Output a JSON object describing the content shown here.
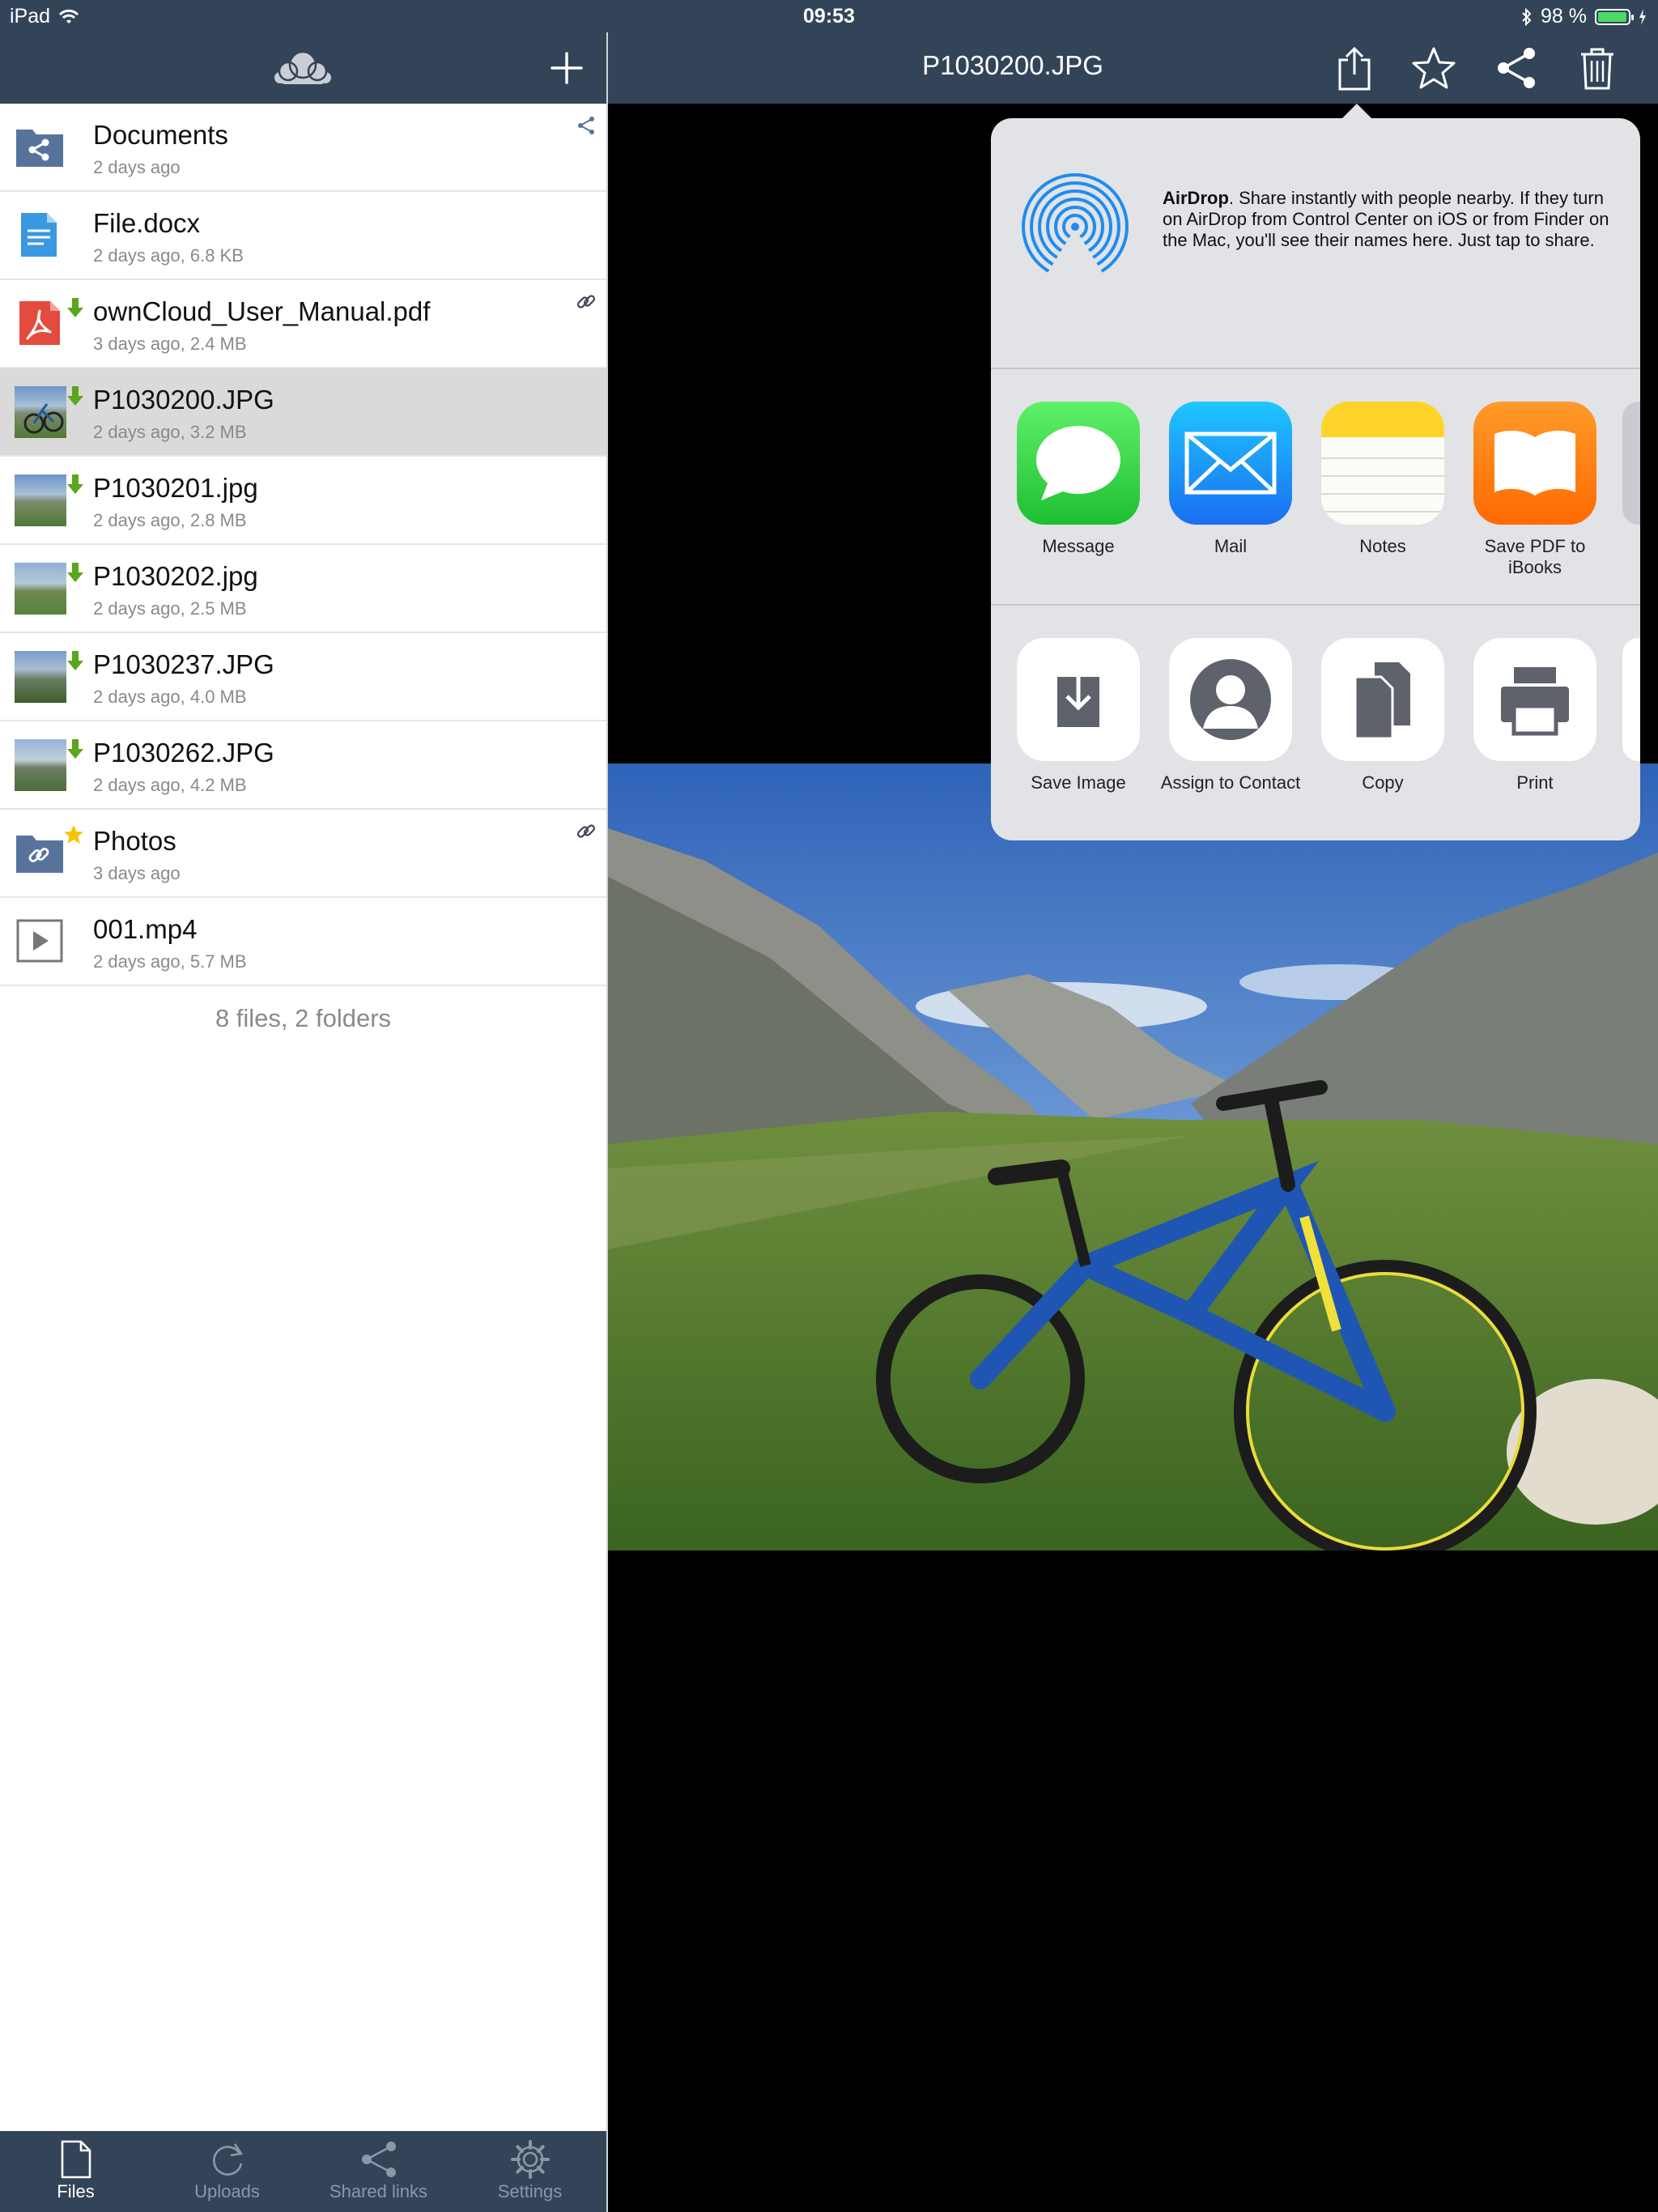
{
  "status_bar": {
    "device": "iPad",
    "time": "09:53",
    "battery": "98 %",
    "battery_level": 0.98
  },
  "preview": {
    "title": "P1030200.JPG"
  },
  "files": [
    {
      "name": "Documents",
      "meta": "2 days ago",
      "type": "folder-shared",
      "badge": "",
      "corner": "share-icon",
      "selected": false
    },
    {
      "name": "File.docx",
      "meta": "2 days ago, 6.8 KB",
      "type": "doc",
      "badge": "",
      "corner": "",
      "selected": false
    },
    {
      "name": "ownCloud_User_Manual.pdf",
      "meta": "3 days ago, 2.4 MB",
      "type": "pdf",
      "badge": "downloaded",
      "corner": "link-icon",
      "selected": false
    },
    {
      "name": "P1030200.JPG",
      "meta": "2 days ago, 3.2 MB",
      "type": "image",
      "badge": "downloaded",
      "corner": "",
      "selected": true
    },
    {
      "name": "P1030201.jpg",
      "meta": "2 days ago, 2.8 MB",
      "type": "image",
      "badge": "downloaded",
      "corner": "",
      "selected": false
    },
    {
      "name": "P1030202.jpg",
      "meta": "2 days ago, 2.5 MB",
      "type": "image",
      "badge": "downloaded",
      "corner": "",
      "selected": false
    },
    {
      "name": "P1030237.JPG",
      "meta": "2 days ago, 4.0 MB",
      "type": "image",
      "badge": "downloaded",
      "corner": "",
      "selected": false
    },
    {
      "name": "P1030262.JPG",
      "meta": "2 days ago, 4.2 MB",
      "type": "image",
      "badge": "downloaded",
      "corner": "",
      "selected": false
    },
    {
      "name": "Photos",
      "meta": "3 days ago",
      "type": "folder-link",
      "badge": "favorite",
      "corner": "link-icon",
      "selected": false
    },
    {
      "name": "001.mp4",
      "meta": "2 days ago, 5.7 MB",
      "type": "video",
      "badge": "",
      "corner": "",
      "selected": false
    }
  ],
  "summary": "8 files, 2 folders",
  "tabs": [
    {
      "label": "Files",
      "icon": "file-icon",
      "active": true
    },
    {
      "label": "Uploads",
      "icon": "refresh-icon",
      "active": false
    },
    {
      "label": "Shared links",
      "icon": "share-icon",
      "active": false
    },
    {
      "label": "Settings",
      "icon": "gear-icon",
      "active": false
    }
  ],
  "share_sheet": {
    "airdrop_title": "AirDrop",
    "airdrop_text": ". Share instantly with people nearby. If they turn on AirDrop from Control Center on iOS or from Finder on the Mac, you'll see their names here. Just tap to share.",
    "apps": [
      {
        "label": "Message",
        "icon": "message-icon"
      },
      {
        "label": "Mail",
        "icon": "mail-icon"
      },
      {
        "label": "Notes",
        "icon": "notes-icon"
      },
      {
        "label": "Save PDF to iBooks",
        "icon": "ibooks-icon"
      }
    ],
    "actions": [
      {
        "label": "Save Image",
        "icon": "save-image-icon"
      },
      {
        "label": "Assign to Contact",
        "icon": "contact-icon"
      },
      {
        "label": "Copy",
        "icon": "copy-icon"
      },
      {
        "label": "Print",
        "icon": "print-icon"
      }
    ]
  },
  "colors": {
    "nav": "#334459",
    "selected_row": "#dadada",
    "accent_download": "#5aa61e",
    "favorite": "#f5c400"
  }
}
